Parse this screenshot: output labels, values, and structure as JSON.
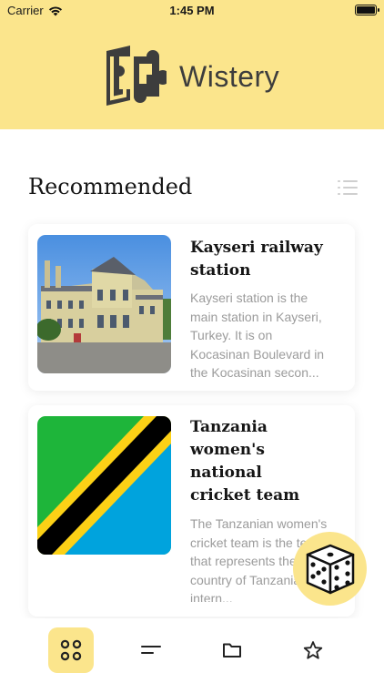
{
  "status_bar": {
    "carrier": "Carrier",
    "time": "1:45 PM"
  },
  "header": {
    "app_name": "Wistery"
  },
  "section": {
    "title": "Recommended"
  },
  "cards": [
    {
      "title": "Kayseri railway station",
      "description": "Kayseri station is the main station in Kayseri, Turkey. It is on Kocasinan Boulevard in the Kocasinan secon..."
    },
    {
      "title": "Tanzania women's national cricket team",
      "description": "The Tanzanian women's cricket team is the team that represents the country of Tanzania in intern..."
    }
  ],
  "tabbar": {
    "items": [
      "grid-icon",
      "lines-icon",
      "folder-icon",
      "star-icon"
    ],
    "selected": "grid-icon"
  },
  "colors": {
    "accent": "#fbe58c",
    "text_dark": "#161616",
    "text_muted": "#9b9b9b"
  }
}
